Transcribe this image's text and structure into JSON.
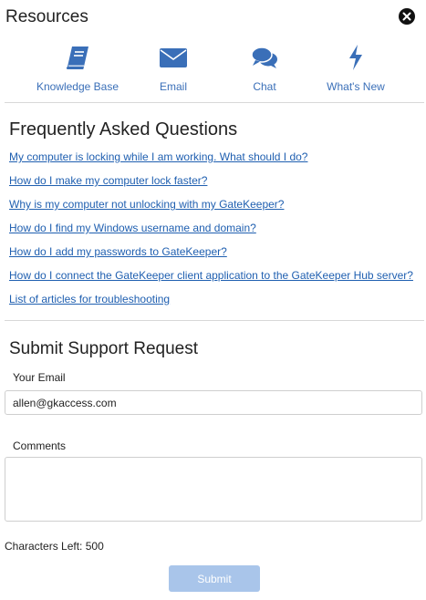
{
  "header": {
    "title": "Resources"
  },
  "resources": [
    {
      "label": "Knowledge Base",
      "icon": "book-icon"
    },
    {
      "label": "Email",
      "icon": "envelope-icon"
    },
    {
      "label": "Chat",
      "icon": "chat-bubbles-icon"
    },
    {
      "label": "What's New",
      "icon": "lightning-icon"
    }
  ],
  "faq": {
    "title": "Frequently Asked Questions",
    "links": [
      "My computer is locking while I am working. What should I do?",
      "How do I make my computer lock faster?",
      "Why is my computer not unlocking with my GateKeeper?",
      "How do I find my Windows username and domain?",
      "How do I add my passwords to GateKeeper?",
      "How do I connect the GateKeeper client application to the GateKeeper Hub server?",
      "List of articles for troubleshooting"
    ]
  },
  "support": {
    "title": "Submit Support Request",
    "email_label": "Your Email",
    "email_value": "allen@gkaccess.com",
    "comments_label": "Comments",
    "comments_value": "",
    "chars_left_label": "Characters Left:",
    "chars_left_value": "500",
    "submit_label": "Submit"
  },
  "colors": {
    "accent": "#3a6fb8",
    "link": "#1f5fb0",
    "submit_disabled": "#a9c5ea"
  }
}
